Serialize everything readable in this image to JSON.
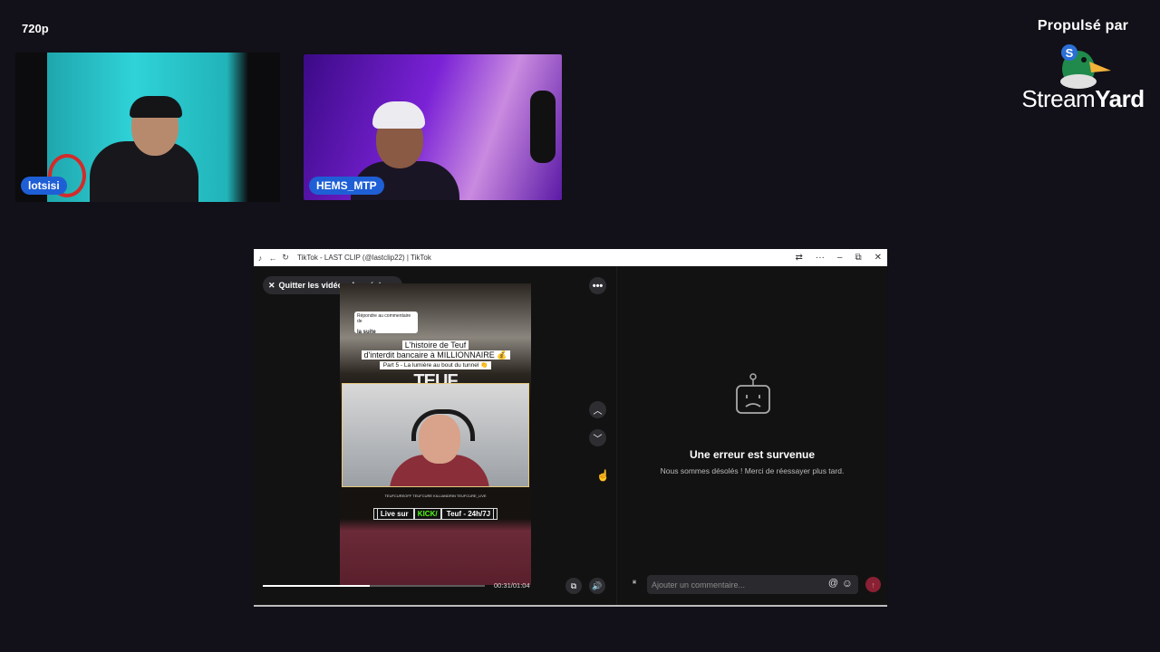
{
  "overlay": {
    "quality": "720p",
    "powered_by": "Propulsé par",
    "brand_name_light": "Stream",
    "brand_name_bold": "Yard"
  },
  "cameras": [
    {
      "name": "lotsisi"
    },
    {
      "name": "HEMS_MTP"
    }
  ],
  "browser": {
    "title": "TikTok - LAST CLIP (@lastclip22) | TikTok",
    "back_icon": "←",
    "reload_icon": "↻",
    "minimize_icon": "–",
    "restore_icon": "⧉",
    "close_icon": "✕"
  },
  "video": {
    "quit_label": "Quitter les vidéos du créateur",
    "more_label": "•••",
    "reply_note": "Répondre au commentaire de",
    "reply_text": "la suite",
    "clip_title_line1": "L'histoire de Teuf",
    "clip_title_line2": "d'interdit bancaire à MILLIONNAIRE 💰",
    "clip_subtitle": "Part 5 - La lumière au bout du tunnel 👏",
    "clip_logo": "TEUF",
    "socials": "TEUFCUREOFF   TEUFCURE   KILLIANDRIN   TEUFCURE_LIVE",
    "kick_prefix": "Live sur ",
    "kick_highlight": "KICK/",
    "kick_suffix": " Teuf - 24h/7J",
    "time": "00:31/01:04",
    "progress": 0.48
  },
  "comments": {
    "error_title": "Une erreur est survenue",
    "error_message": "Nous sommes désolés ! Merci de réessayer plus tard.",
    "input_placeholder": "Ajouter un commentaire...",
    "at_icon": "@",
    "emoji_icon": "☺",
    "send_icon": "↑"
  },
  "colors": {
    "nametag": "#1e5fd6",
    "send_button": "#8a2033",
    "kick_green": "#53fc18"
  }
}
